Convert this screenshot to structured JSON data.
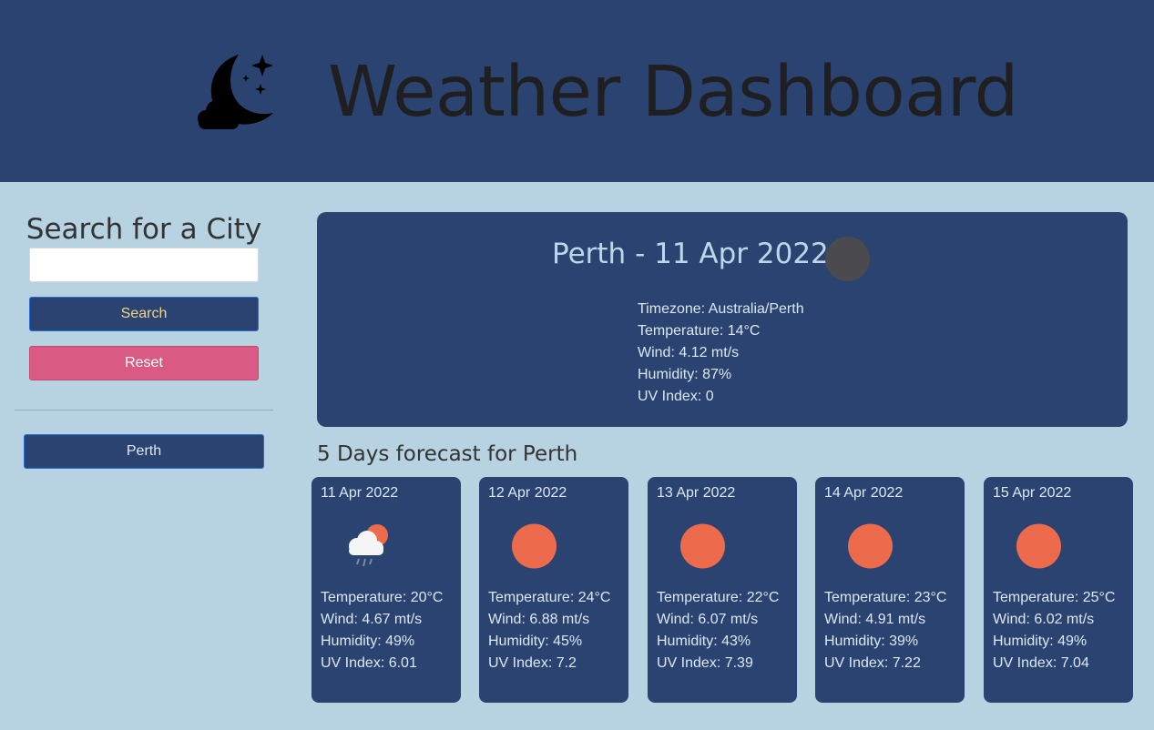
{
  "header": {
    "title": "Weather Dashboard",
    "logo_icon": "moon-cloud-stars-icon"
  },
  "sidebar": {
    "title": "Search for a City",
    "search_value": "",
    "search_label": "Search",
    "reset_label": "Reset",
    "history": [
      "Perth"
    ]
  },
  "current": {
    "title": "Perth - 11 Apr 2022",
    "icon": "dark-circle-icon",
    "timezone": "Timezone: Australia/Perth",
    "temperature": "Temperature: 14°C",
    "wind": "Wind: 4.12 mt/s",
    "humidity": "Humidity: 87%",
    "uv": "UV Index: 0"
  },
  "forecast": {
    "heading": "5 Days forecast for Perth",
    "days": [
      {
        "date": "11 Apr 2022",
        "icon": "rain-cloud-sun-icon",
        "temperature": "Temperature: 20°C",
        "wind": "Wind: 4.67 mt/s",
        "humidity": "Humidity: 49%",
        "uv": "UV Index: 6.01"
      },
      {
        "date": "12 Apr 2022",
        "icon": "sun-icon",
        "temperature": "Temperature: 24°C",
        "wind": "Wind: 6.88 mt/s",
        "humidity": "Humidity: 45%",
        "uv": "UV Index: 7.2"
      },
      {
        "date": "13 Apr 2022",
        "icon": "sun-icon",
        "temperature": "Temperature: 22°C",
        "wind": "Wind: 6.07 mt/s",
        "humidity": "Humidity: 43%",
        "uv": "UV Index: 7.39"
      },
      {
        "date": "14 Apr 2022",
        "icon": "sun-icon",
        "temperature": "Temperature: 23°C",
        "wind": "Wind: 4.91 mt/s",
        "humidity": "Humidity: 39%",
        "uv": "UV Index: 7.22"
      },
      {
        "date": "15 Apr 2022",
        "icon": "sun-icon",
        "temperature": "Temperature: 25°C",
        "wind": "Wind: 6.02 mt/s",
        "humidity": "Humidity: 49%",
        "uv": "UV Index: 7.04"
      }
    ]
  },
  "colors": {
    "navy": "#2b4370",
    "background": "#b7d3e1",
    "accent_pink": "#d95a82",
    "sun": "#ec6b4c"
  }
}
